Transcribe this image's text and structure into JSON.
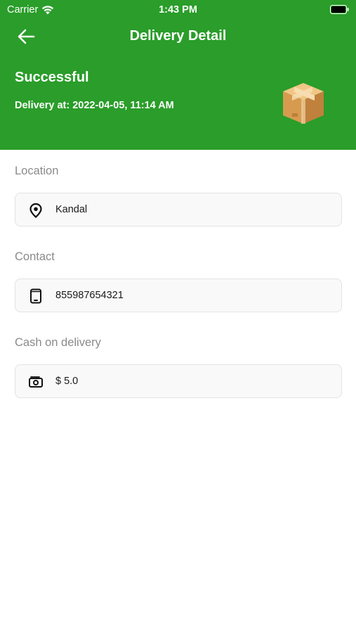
{
  "status_bar": {
    "carrier": "Carrier",
    "time": "1:43 PM"
  },
  "nav": {
    "title": "Delivery Detail"
  },
  "summary": {
    "status": "Successful",
    "delivered_at": "Delivery at: 2022-04-05, 11:14 AM"
  },
  "sections": {
    "location": {
      "label": "Location",
      "value": "Kandal"
    },
    "contact": {
      "label": "Contact",
      "value": "855987654321"
    },
    "cod": {
      "label": "Cash on delivery",
      "value": "$ 5.0"
    }
  },
  "colors": {
    "header": "#2a9d2a"
  }
}
